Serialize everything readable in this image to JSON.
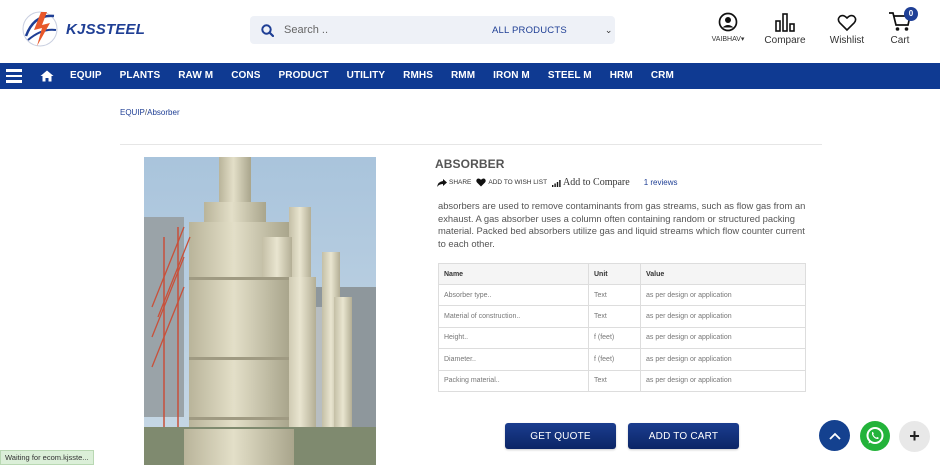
{
  "brand": {
    "name": "KJSSTEEL",
    "colors": {
      "primary": "#0f3a92",
      "accent": "#e8582b",
      "whatsapp": "#23b33a"
    }
  },
  "search": {
    "placeholder": "Search ..",
    "category": "ALL PRODUCTS"
  },
  "header": {
    "user_label": "VAIBHAV",
    "compare_label": "Compare",
    "wishlist_label": "Wishlist",
    "cart_label": "Cart",
    "cart_count": "0"
  },
  "nav": {
    "links": [
      "EQUIP",
      "PLANTS",
      "RAW M",
      "CONS",
      "PRODUCT",
      "UTILITY",
      "RMHS",
      "RMM",
      "IRON M",
      "STEEL M",
      "HRM",
      "CRM"
    ]
  },
  "breadcrumb": {
    "parent": "EQUIP",
    "separator": "/",
    "current": "Absorber"
  },
  "product": {
    "title": "ABSORBER",
    "share_label": "SHARE",
    "wishlist_label": "ADD TO WISH LIST",
    "compare_label": "Add to Compare",
    "reviews": "1 reviews",
    "description": "absorbers are used to remove contaminants from gas streams, such as flow gas from an exhaust. A gas absorber uses a column often containing random or structured packing material. Packed bed absorbers utilize gas and liquid streams which flow counter current to each other.",
    "spec_headers": [
      "Name",
      "Unit",
      "Value"
    ],
    "specs": [
      [
        "Absorber type..",
        "Text",
        "as per design or application"
      ],
      [
        "Material of construction..",
        "Text",
        "as per design or application"
      ],
      [
        "Height..",
        "f (feet)",
        "as per design or application"
      ],
      [
        "Diameter..",
        "f (feet)",
        "as per design or application"
      ],
      [
        "Packing material..",
        "Text",
        "as per design or application"
      ]
    ],
    "quote_label": "GET QUOTE",
    "cart_label": "ADD TO CART"
  },
  "status": "Waiting for ecom.kjsste..."
}
